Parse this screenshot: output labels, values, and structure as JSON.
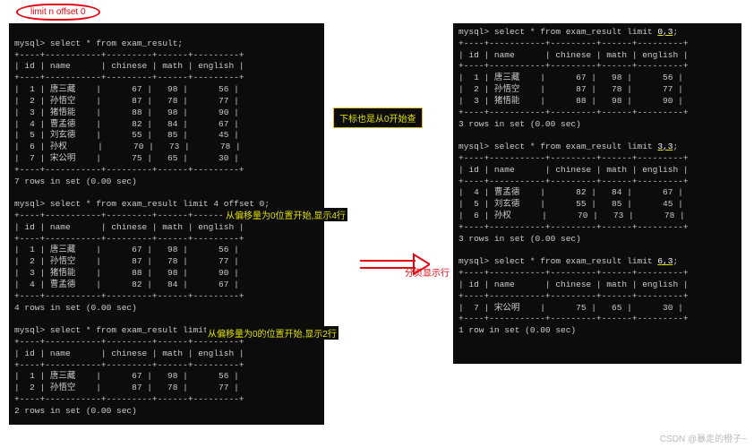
{
  "badge": "limit n offset 0",
  "annotations": {
    "boxed": "下标也是从0开始查",
    "note1": "从偏移量为0位置开始,显示4行",
    "note2": "从偏移量为0的位置开始,显示2行",
    "note3": "分页显示行"
  },
  "watermark": "CSDN @暴走的橙子~",
  "left": {
    "q1": {
      "cmd": "mysql> select * from exam_result;",
      "headers": [
        "id",
        "name",
        "chinese",
        "math",
        "english"
      ],
      "rows": [
        [
          "1",
          "唐三藏",
          "67",
          "98",
          "56"
        ],
        [
          "2",
          "孙悟空",
          "87",
          "78",
          "77"
        ],
        [
          "3",
          "猪悟能",
          "88",
          "98",
          "90"
        ],
        [
          "4",
          "曹孟德",
          "82",
          "84",
          "67"
        ],
        [
          "5",
          "刘玄德",
          "55",
          "85",
          "45"
        ],
        [
          "6",
          "孙权",
          "70",
          "73",
          "78"
        ],
        [
          "7",
          "宋公明",
          "75",
          "65",
          "30"
        ]
      ],
      "footer": "7 rows in set (0.00 sec)"
    },
    "q2": {
      "cmd": "mysql> select * from exam_result limit 4 offset 0;",
      "headers": [
        "id",
        "name",
        "chinese",
        "math",
        "english"
      ],
      "rows": [
        [
          "1",
          "唐三藏",
          "67",
          "98",
          "56"
        ],
        [
          "2",
          "孙悟空",
          "87",
          "78",
          "77"
        ],
        [
          "3",
          "猪悟能",
          "88",
          "98",
          "90"
        ],
        [
          "4",
          "曹孟德",
          "82",
          "84",
          "67"
        ]
      ],
      "footer": "4 rows in set (0.00 sec)"
    },
    "q3": {
      "cmd": "mysql> select * from exam_result limit 2 offset 0;",
      "headers": [
        "id",
        "name",
        "chinese",
        "math",
        "english"
      ],
      "rows": [
        [
          "1",
          "唐三藏",
          "67",
          "98",
          "56"
        ],
        [
          "2",
          "孙悟空",
          "87",
          "78",
          "77"
        ]
      ],
      "footer": "2 rows in set (0.00 sec)"
    }
  },
  "right": {
    "q1": {
      "cmd_pre": "mysql> select * from exam_result limit ",
      "cmd_hl": "0,3",
      "cmd_post": ";",
      "headers": [
        "id",
        "name",
        "chinese",
        "math",
        "english"
      ],
      "rows": [
        [
          "1",
          "唐三藏",
          "67",
          "98",
          "56"
        ],
        [
          "2",
          "孙悟空",
          "87",
          "78",
          "77"
        ],
        [
          "3",
          "猪悟能",
          "88",
          "98",
          "90"
        ]
      ],
      "footer": "3 rows in set (0.00 sec)"
    },
    "q2": {
      "cmd_pre": "mysql> select * from exam_result limit ",
      "cmd_hl": "3,3",
      "cmd_post": ";",
      "headers": [
        "id",
        "name",
        "chinese",
        "math",
        "english"
      ],
      "rows": [
        [
          "4",
          "曹孟德",
          "82",
          "84",
          "67"
        ],
        [
          "5",
          "刘玄德",
          "55",
          "85",
          "45"
        ],
        [
          "6",
          "孙权",
          "70",
          "73",
          "78"
        ]
      ],
      "footer": "3 rows in set (0.00 sec)"
    },
    "q3": {
      "cmd_pre": "mysql> select * from exam_result limit ",
      "cmd_hl": "6,3",
      "cmd_post": ";",
      "headers": [
        "id",
        "name",
        "chinese",
        "math",
        "english"
      ],
      "rows": [
        [
          "7",
          "宋公明",
          "75",
          "65",
          "30"
        ]
      ],
      "footer": "1 row in set (0.00 sec)"
    }
  }
}
